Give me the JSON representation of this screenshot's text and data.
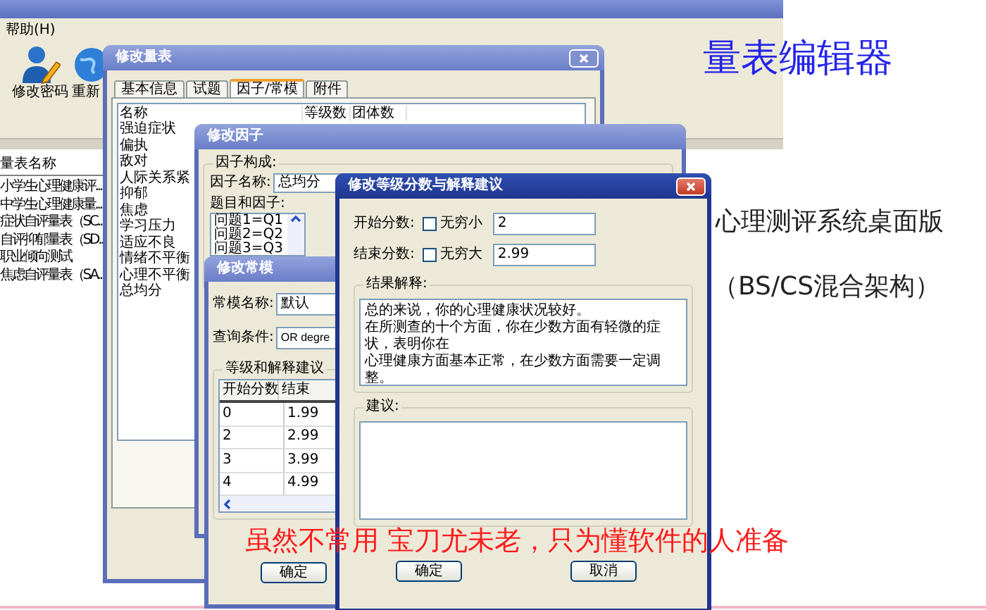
{
  "main_window": {
    "menu": [
      "帮助(H)"
    ],
    "toolbar": [
      {
        "label": "修改密码",
        "kind": "user"
      },
      {
        "label": "重新",
        "kind": "globe"
      }
    ],
    "scale_list": {
      "column": "量表名称",
      "rows": [
        "小学生心理健康评...",
        "中学生心理健康量...",
        "症状自评量表（SC...",
        "自评抑郁量表（SD...",
        "职业倾向测试",
        "焦虑自评量表（SA..."
      ]
    }
  },
  "scale_dialog": {
    "title": "修改量表",
    "tabs": [
      {
        "label": "基本信息",
        "selected": false
      },
      {
        "label": "试题",
        "selected": false
      },
      {
        "label": "因子/常模",
        "selected": true
      },
      {
        "label": "附件",
        "selected": false
      }
    ],
    "columns": [
      "名称",
      "等级数",
      "团体数"
    ],
    "rows": [
      "强迫症状",
      "偏执",
      "敌对",
      "人际关系紧",
      "抑郁",
      "焦虑",
      "学习压力",
      "适应不良",
      "情绪不平衡",
      "心理不平衡",
      "总均分"
    ]
  },
  "factor_dialog": {
    "title": "修改因子",
    "group": "因子构成:",
    "name_label": "因子名称:",
    "name_value": "总均分",
    "items_label": "题目和因子:",
    "items": [
      "问题1=Q1",
      "问题2=Q2",
      "问题3=Q3"
    ]
  },
  "norm_dialog": {
    "title": "修改常模",
    "name_label": "常模名称:",
    "name_value": "默认",
    "query_label": "查询条件:",
    "query_value": "OR degre",
    "group": "等级和解释建议",
    "columns": [
      "开始分数",
      "结束"
    ],
    "rows": [
      [
        "0",
        "1.99"
      ],
      [
        "2",
        "2.99"
      ],
      [
        "3",
        "3.99"
      ],
      [
        "4",
        "4.99"
      ]
    ],
    "ok": "确定"
  },
  "level_dialog": {
    "title": "修改等级分数与解释建议",
    "start": {
      "label": "开始分数:",
      "option": "无穷小",
      "checked": false,
      "value": "2"
    },
    "end": {
      "label": "结束分数:",
      "option": "无穷大",
      "checked": false,
      "value": "2.99"
    },
    "result_group": "结果解释:",
    "result_lines": [
      "总的来说，你的心理健康状况较好。",
      "在所测查的十个方面，你在少数方面有轻微的症状，表明你在",
      "心理健康方面基本正常，在少数方面需要一定调整。"
    ],
    "advice_group": "建议:",
    "buttons": [
      "确定",
      "取消"
    ]
  },
  "overlay": {
    "heading": "量表编辑器",
    "subtitle": "心理测评系统桌面版",
    "note": "（BS/CS混合架构）",
    "slogan": "虽然不常用 宝刀尤未老，只为懂软件的人准备"
  }
}
